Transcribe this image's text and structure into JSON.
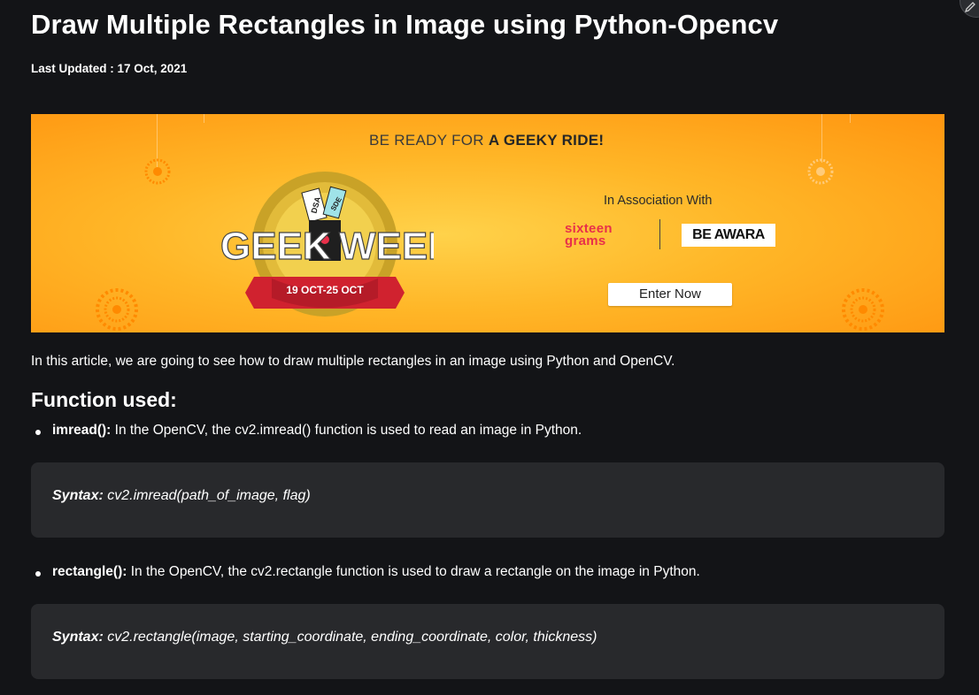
{
  "article": {
    "title": "Draw Multiple Rectangles in Image using Python-Opencv",
    "last_updated": "Last Updated : 17 Oct, 2021"
  },
  "banner": {
    "headline_prefix": "BE READY FOR ",
    "headline_bold": "A GEEKY RIDE!",
    "event_name_left": "GEEK",
    "event_name_right": "WEEK",
    "event_dates": "19 OCT-25 OCT",
    "ticket_1": "DSA",
    "ticket_2": "SDE",
    "association": "In Association With",
    "sponsor_1_line1": "sixteen",
    "sponsor_1_line2": "grams",
    "sponsor_2": "BE AWARA",
    "cta": "Enter Now",
    "colors": {
      "bg_center": "#ffd24a",
      "bg_edge": "#ff9510",
      "ribbon": "#d0222f",
      "sponsor_red": "#e8304a"
    }
  },
  "intro": "In this article, we are going to see how to draw multiple rectangles in an image using Python and OpenCV.",
  "section_heading": "Function used:",
  "functions": [
    {
      "name": "imread():",
      "description": " In the OpenCV, the cv2.imread() function is used to read an image in Python.",
      "syntax_label": "Syntax:",
      "syntax": " cv2.imread(path_of_image, flag)"
    },
    {
      "name": "rectangle():",
      "description": " In the OpenCV, the cv2.rectangle function is used to draw a rectangle on the image in Python.",
      "syntax_label": "Syntax:",
      "syntax": " cv2.rectangle(image, starting_coordinate, ending_coordinate, color, thickness)"
    }
  ],
  "colors": {
    "page_bg": "#131417",
    "code_bg": "#28292c",
    "text": "#ffffff"
  },
  "icons": {
    "corner": "pencil-edit-icon"
  }
}
